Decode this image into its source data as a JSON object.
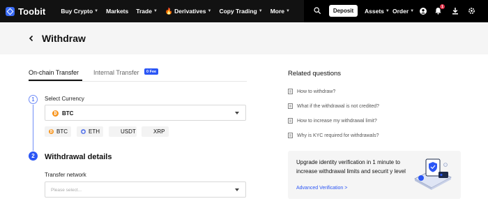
{
  "brand": {
    "name": "Toobit",
    "accent": "#2b56f5",
    "nav_bg": "#121212"
  },
  "nav": {
    "items": [
      {
        "label": "Buy Crypto",
        "has_caret": true
      },
      {
        "label": "Markets",
        "has_caret": false
      },
      {
        "label": "Trade",
        "has_caret": true
      },
      {
        "label": "Derivatives",
        "has_caret": true,
        "icon": "flame-icon"
      },
      {
        "label": "Copy Trading",
        "has_caret": true
      },
      {
        "label": "More",
        "has_caret": true
      }
    ],
    "deposit_label": "Deposit",
    "assets_label": "Assets",
    "order_label": "Order",
    "notification_count": "1"
  },
  "page": {
    "title": "Withdraw"
  },
  "tabs": [
    {
      "label": "On-chain Transfer",
      "active": true
    },
    {
      "label": "Internal Transfer",
      "active": false,
      "badge": "0 Fee"
    }
  ],
  "step1": {
    "number": "1",
    "label": "Select Currency",
    "selected": "BTC",
    "quick_picks": [
      "BTC",
      "ETH",
      "USDT",
      "XRP"
    ]
  },
  "step2": {
    "number": "2",
    "title": "Withdrawal details",
    "network_label": "Transfer network",
    "network_placeholder": "Please select..."
  },
  "related": {
    "title": "Related questions",
    "items": [
      "How to withdraw?",
      "What if the withdrawal is not credited?",
      "How to increase my withdrawal limit?",
      "Why is KYC required for withdrawals?"
    ]
  },
  "promo": {
    "text": "Upgrade identity verification in 1 minute to increase withdrawal limits and securit y level",
    "link": "Advanced Verification >"
  }
}
